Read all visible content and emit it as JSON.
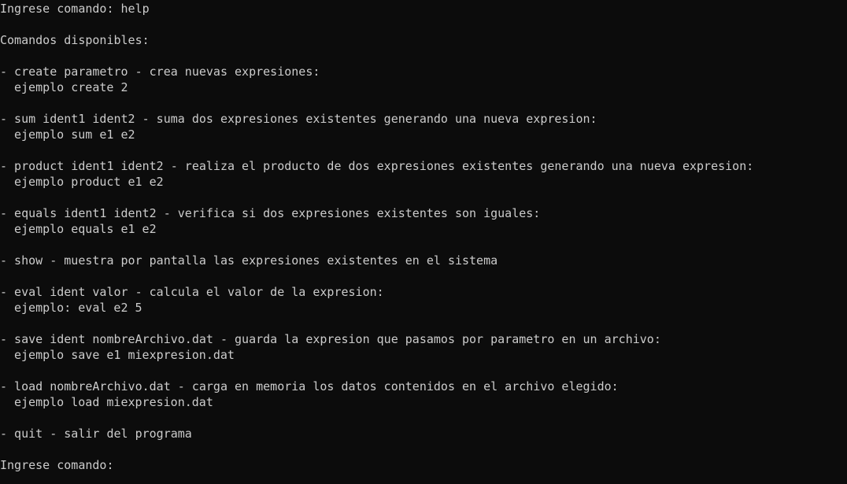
{
  "colors": {
    "background": "#0c0c0c",
    "text": "#cccccc"
  },
  "terminal": {
    "prompt1": {
      "label": "Ingrese comando: ",
      "input": "help"
    },
    "heading": "Comandos disponibles:",
    "commands": [
      {
        "line": "- create parametro - crea nuevas expresiones:",
        "example": "ejemplo create 2"
      },
      {
        "line": "- sum ident1 ident2 - suma dos expresiones existentes generando una nueva expresion:",
        "example": "ejemplo sum e1 e2"
      },
      {
        "line": "- product ident1 ident2 - realiza el producto de dos expresiones existentes generando una nueva expresion:",
        "example": "ejemplo product e1 e2"
      },
      {
        "line": "- equals ident1 ident2 - verifica si dos expresiones existentes son iguales:",
        "example": "ejemplo equals e1 e2"
      },
      {
        "line": "- show - muestra por pantalla las expresiones existentes en el sistema",
        "example": ""
      },
      {
        "line": "- eval ident valor - calcula el valor de la expresion:",
        "example": "ejemplo: eval e2 5"
      },
      {
        "line": "- save ident nombreArchivo.dat - guarda la expresion que pasamos por parametro en un archivo:",
        "example": "ejemplo save e1 miexpresion.dat"
      },
      {
        "line": "- load nombreArchivo.dat - carga en memoria los datos contenidos en el archivo elegido:",
        "example": "ejemplo load miexpresion.dat"
      },
      {
        "line": "- quit - salir del programa",
        "example": ""
      }
    ],
    "prompt2": {
      "label": "Ingrese comando:",
      "input": ""
    }
  }
}
